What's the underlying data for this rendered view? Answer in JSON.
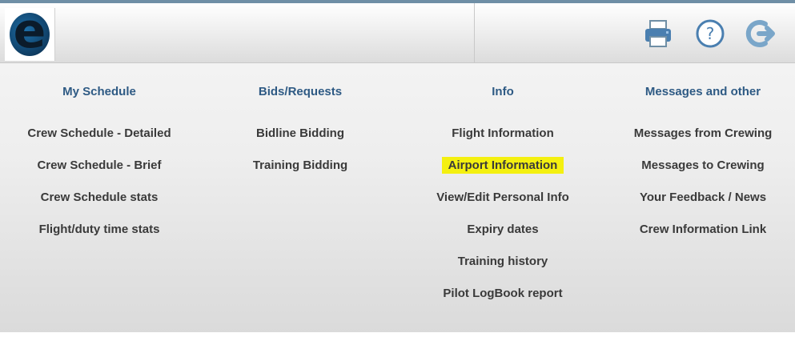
{
  "app": {
    "logo_letter": "e"
  },
  "header": {
    "print_icon": "print-icon",
    "help_icon": "help-icon",
    "logout_icon": "logout-icon",
    "accent_color": "#2e5a84"
  },
  "menu": {
    "columns": [
      {
        "heading": "My Schedule",
        "items": [
          "Crew Schedule - Detailed",
          "Crew Schedule - Brief",
          "Crew Schedule stats",
          "Flight/duty time stats"
        ]
      },
      {
        "heading": "Bids/Requests",
        "items": [
          "Bidline Bidding",
          "Training Bidding"
        ]
      },
      {
        "heading": "Info",
        "items": [
          "Flight Information",
          "Airport Information",
          "View/Edit Personal Info",
          "Expiry dates",
          "Training history",
          "Pilot LogBook report"
        ]
      },
      {
        "heading": "Messages and other",
        "items": [
          "Messages from Crewing",
          "Messages to Crewing",
          "Your Feedback / News",
          "Crew Information Link"
        ]
      }
    ],
    "highlighted_item": "Airport Information"
  }
}
